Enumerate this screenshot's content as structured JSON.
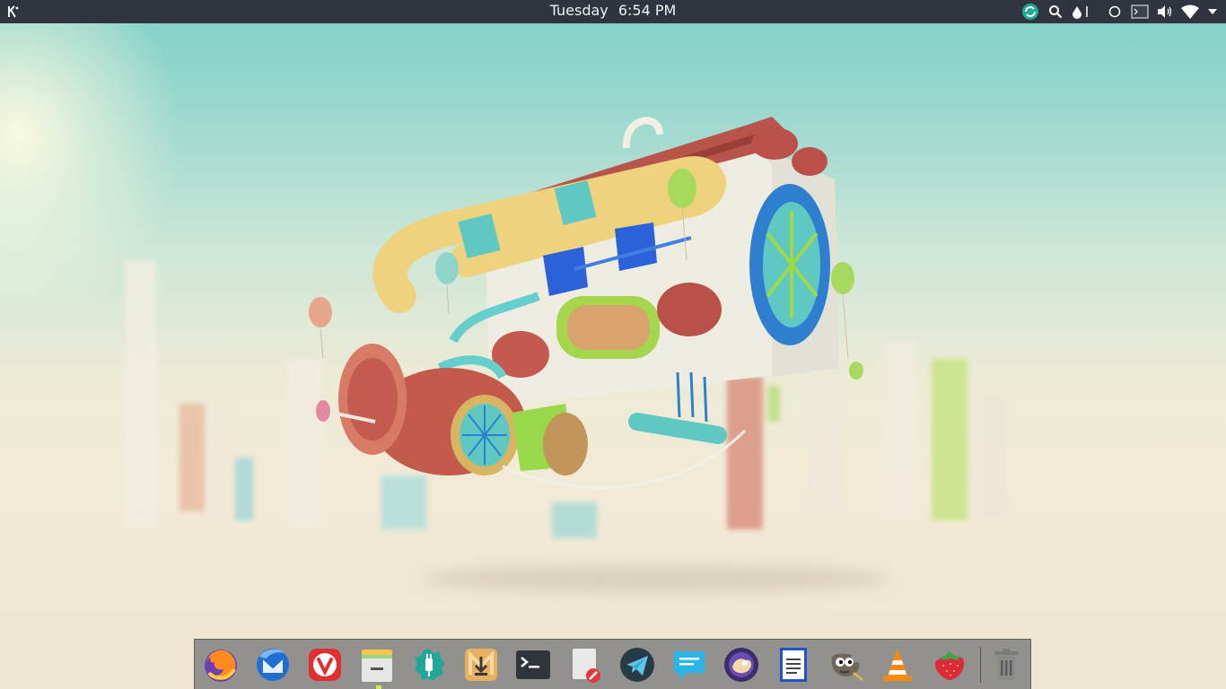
{
  "panel": {
    "clock_day": "Tuesday",
    "clock_time": "6:54 PM",
    "background": "#2f343f",
    "tray_icons": [
      "sync-icon",
      "search-icon",
      "drop-icon",
      "circle-icon",
      "terminal-icon",
      "volume-icon",
      "wifi-icon",
      "chevron-down-icon"
    ]
  },
  "dock": {
    "items": [
      {
        "name": "firefox",
        "icon": "firefox-icon"
      },
      {
        "name": "thunderbird",
        "icon": "thunderbird-icon"
      },
      {
        "name": "vivaldi",
        "icon": "vivaldi-icon"
      },
      {
        "name": "files",
        "icon": "file-manager-icon",
        "active": true
      },
      {
        "name": "kde-connect",
        "icon": "settings-plug-icon"
      },
      {
        "name": "downloader",
        "icon": "download-icon"
      },
      {
        "name": "terminal",
        "icon": "terminal-icon"
      },
      {
        "name": "text-editor",
        "icon": "text-editor-icon"
      },
      {
        "name": "telegram",
        "icon": "telegram-icon"
      },
      {
        "name": "chat",
        "icon": "chat-icon"
      },
      {
        "name": "persepolis",
        "icon": "persepolis-icon"
      },
      {
        "name": "document",
        "icon": "document-icon"
      },
      {
        "name": "gimp",
        "icon": "gimp-icon"
      },
      {
        "name": "vlc",
        "icon": "vlc-icon"
      },
      {
        "name": "strawberry",
        "icon": "strawberry-icon"
      },
      {
        "name": "trash",
        "icon": "trash-icon"
      }
    ]
  },
  "colors": {
    "accent_teal": "#1fa89a",
    "dock_active_indicator": "#d9e84a"
  }
}
